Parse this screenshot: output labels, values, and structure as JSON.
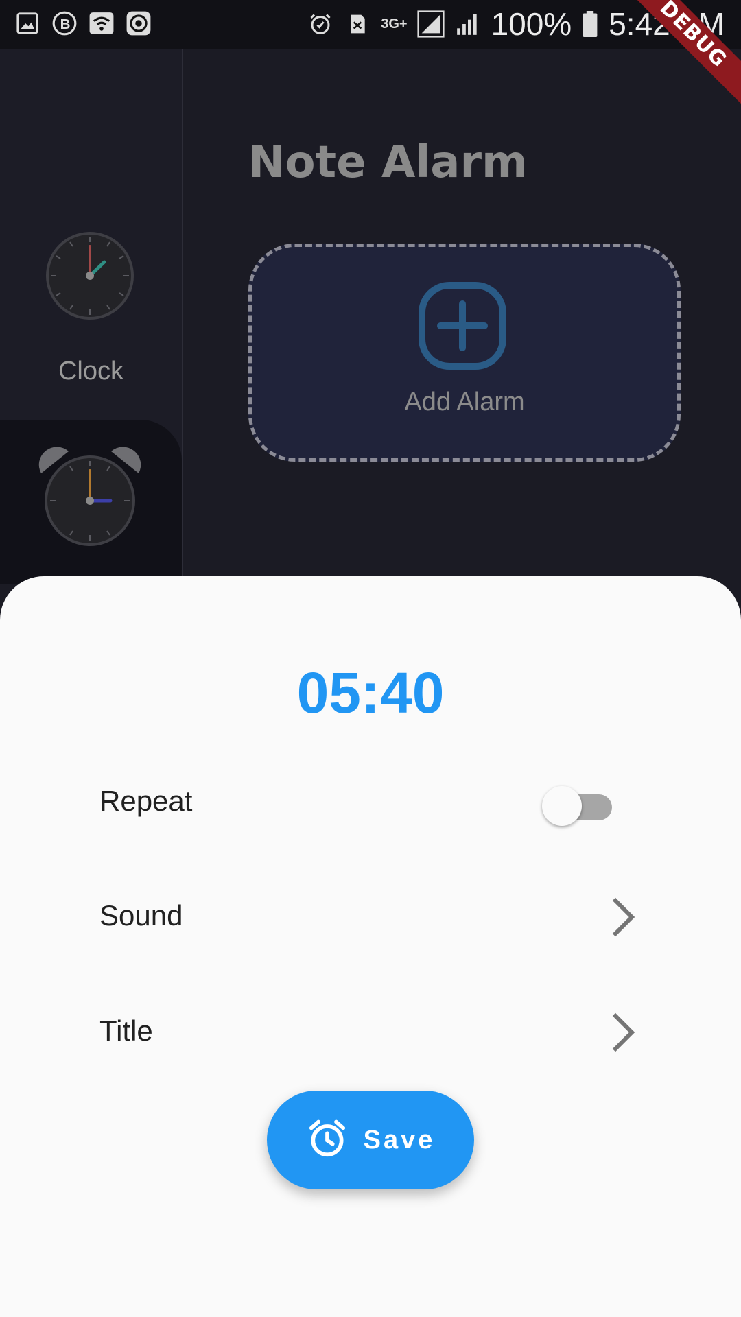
{
  "status_bar": {
    "battery": "100%",
    "time": "5:42 AM",
    "network": "3G+",
    "icons": [
      "gallery-icon",
      "b-icon",
      "wifi-icon",
      "app-icon",
      "alarm-icon",
      "sim-icon",
      "signal-icon",
      "signal2-icon",
      "battery-icon"
    ]
  },
  "debug_banner": "DEBUG",
  "sidebar": {
    "items": [
      {
        "label": "Clock",
        "icon": "clock-icon"
      },
      {
        "label": "",
        "icon": "alarm-clock-icon"
      }
    ]
  },
  "main": {
    "title": "Note Alarm",
    "add_card": {
      "label": "Add Alarm",
      "icon": "plus-square-icon"
    }
  },
  "sheet": {
    "time": "05:40",
    "rows": [
      {
        "label": "Repeat",
        "control": "toggle",
        "value": false
      },
      {
        "label": "Sound",
        "control": "chevron-right-icon"
      },
      {
        "label": "Title",
        "control": "chevron-right-icon"
      }
    ],
    "save_button": {
      "label": "Save",
      "icon": "alarm-icon"
    }
  },
  "colors": {
    "accent": "#2196f3",
    "background_dark": "#1b1b24",
    "sheet_background": "#fafafa",
    "debug_ribbon": "#8e1a1f"
  }
}
